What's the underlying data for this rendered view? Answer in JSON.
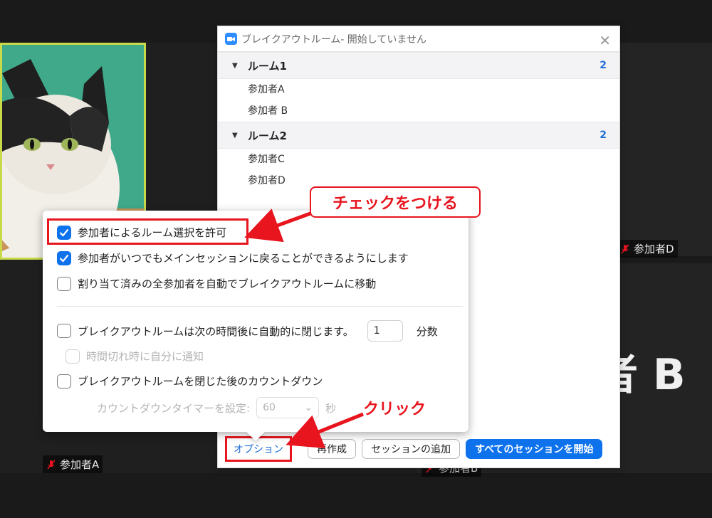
{
  "meeting": {
    "participants": {
      "a": "参加者A",
      "d": "参加者D",
      "b_big": "者 B",
      "b_partial": "参加者B"
    }
  },
  "breakout_window": {
    "title": "ブレイクアウトルーム- 開始していません",
    "rooms": [
      {
        "name": "ルーム1",
        "count": "2",
        "participants": [
          "参加者A",
          "参加者 B"
        ]
      },
      {
        "name": "ルーム2",
        "count": "2",
        "participants": [
          "参加者C",
          "参加者D"
        ]
      }
    ],
    "footer": {
      "options_label": "オプション",
      "recreate_label": "再作成",
      "add_session_label": "セッションの追加",
      "start_all_label": "すべてのセッションを開始"
    }
  },
  "options_popover": {
    "allow_choose_room": {
      "label": "参加者によるルーム選択を許可",
      "checked": true
    },
    "allow_return": {
      "label": "参加者がいつでもメインセッションに戻ることができるようにします",
      "checked": true
    },
    "auto_move": {
      "label": "割り当て済みの全参加者を自動でブレイクアウトルームに移動",
      "checked": false
    },
    "auto_close": {
      "label": "ブレイクアウトルームは次の時間後に自動的に閉じます。",
      "checked": false,
      "value": "1",
      "unit": "分数"
    },
    "notify": {
      "label": "時間切れ時に自分に通知",
      "checked": false,
      "disabled": true
    },
    "countdown": {
      "label": "ブレイクアウトルームを閉じた後のカウントダウン",
      "checked": false
    },
    "countdown_timer": {
      "label": "カウントダウンタイマーを設定:",
      "value": "60",
      "unit": "秒",
      "disabled": true
    }
  },
  "annotations": {
    "check_callout": "チェックをつける",
    "click_label": "クリック",
    "accent_color": "#e8141e"
  },
  "colors": {
    "primary_blue": "#0e72ed",
    "count_blue": "#1f6ed4",
    "background": "#1a1a1a"
  }
}
